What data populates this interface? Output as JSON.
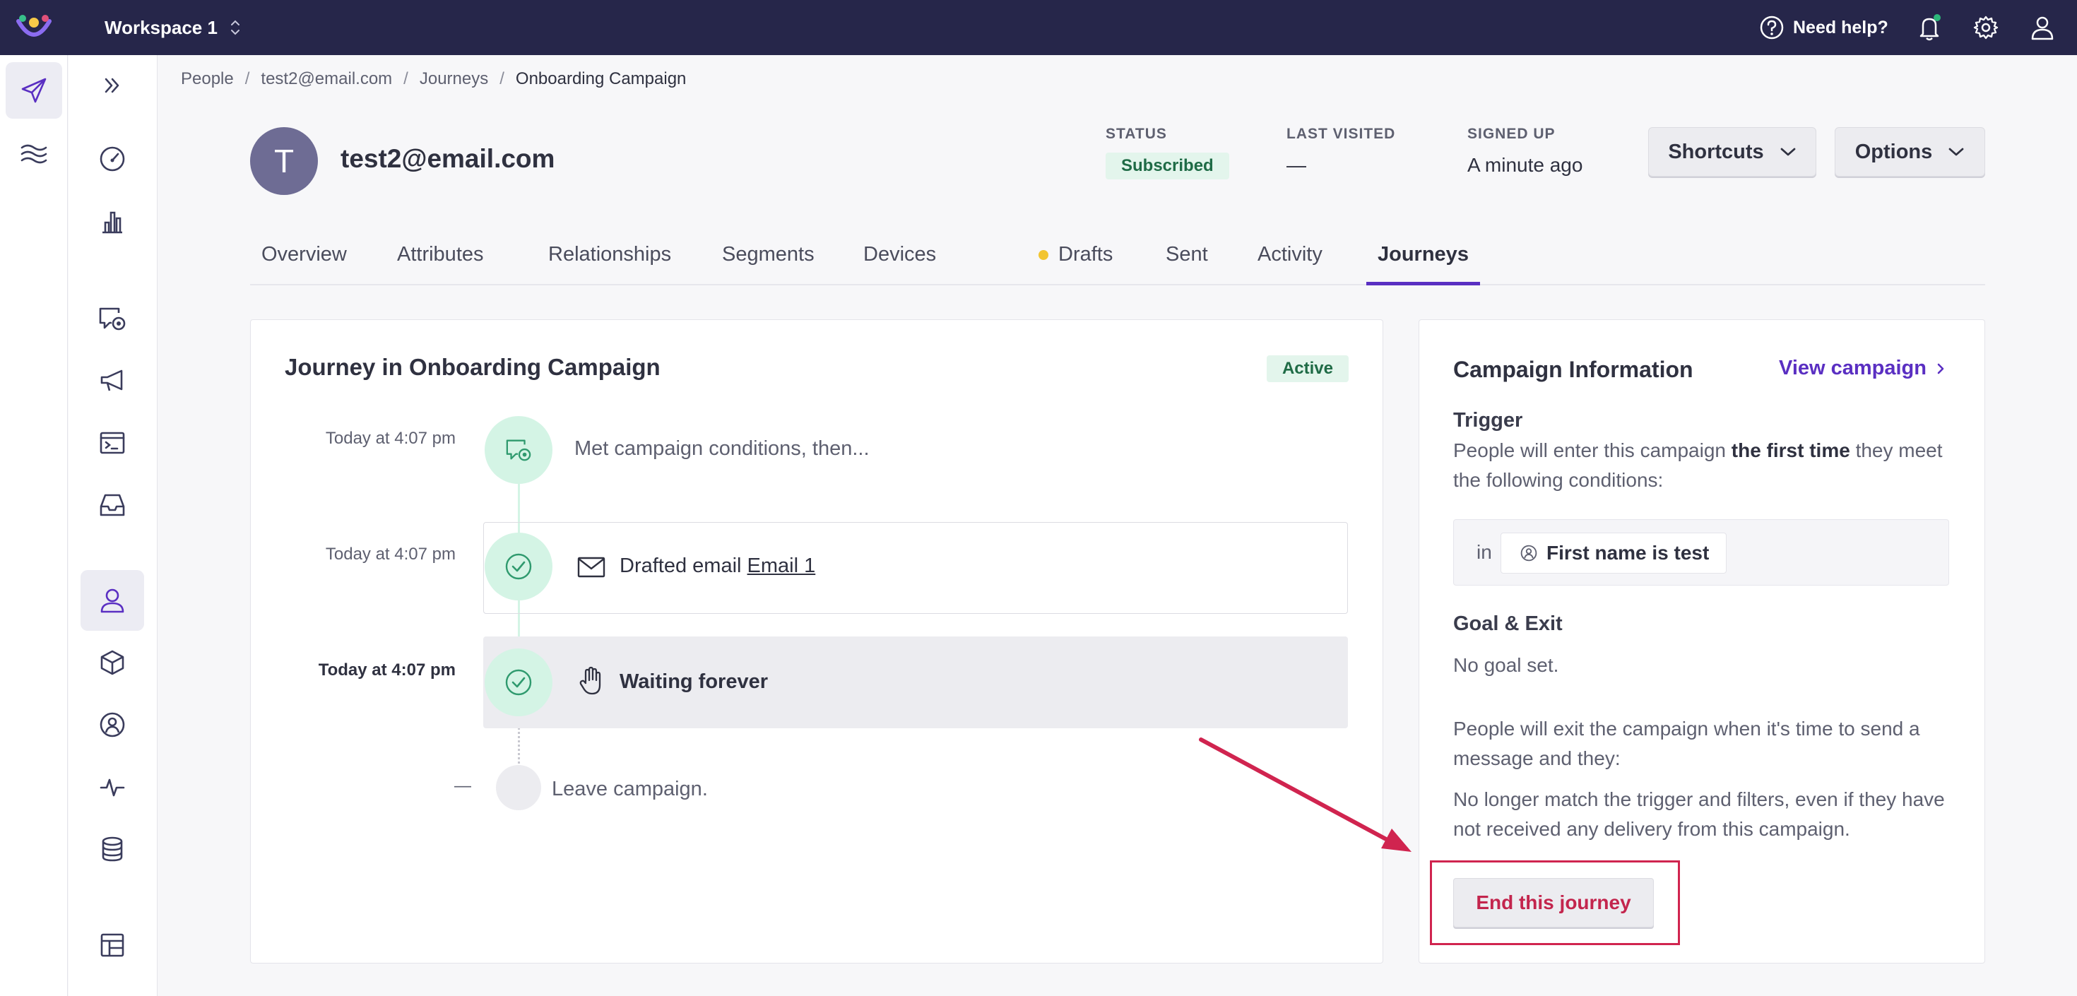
{
  "topbar": {
    "workspace": "Workspace 1",
    "help_label": "Need help?",
    "colors": {
      "background": "#26264a",
      "notification_dot": "#2db87a"
    }
  },
  "breadcrumb": [
    "People",
    "test2@email.com",
    "Journeys",
    "Onboarding Campaign"
  ],
  "profile": {
    "initial": "T",
    "email": "test2@email.com",
    "status_label": "STATUS",
    "status_value": "Subscribed",
    "last_visited_label": "LAST VISITED",
    "last_visited_value": "—",
    "signed_up_label": "SIGNED UP",
    "signed_up_value": "A minute ago",
    "shortcuts_label": "Shortcuts",
    "options_label": "Options"
  },
  "tabs": [
    "Overview",
    "Attributes",
    "Relationships",
    "Segments",
    "Devices",
    "Drafts",
    "Sent",
    "Activity",
    "Journeys"
  ],
  "active_tab": "Journeys",
  "journey": {
    "title": "Journey in Onboarding Campaign",
    "badge": "Active",
    "steps": [
      {
        "time": "Today at 4:07 pm",
        "text": "Met campaign conditions, then..."
      },
      {
        "time": "Today at 4:07 pm",
        "text_prefix": "Drafted email",
        "link": "Email 1"
      },
      {
        "time": "Today at 4:07 pm",
        "text": "Waiting forever"
      },
      {
        "time": "—",
        "text": "Leave campaign."
      }
    ]
  },
  "campaign_info": {
    "title": "Campaign Information",
    "view_link": "View campaign",
    "trigger_heading": "Trigger",
    "trigger_text_pre": "People will enter this campaign",
    "trigger_text_bold": "the first time",
    "trigger_text_post": "they meet the following conditions:",
    "condition_in": "in",
    "condition": "First name is test",
    "goal_heading": "Goal & Exit",
    "goal_text": "No goal set.",
    "exit_text": "People will exit the campaign when it's time to send a message and they:",
    "exit_condition": "No longer match the trigger and filters, even if they have not received any delivery from this campaign.",
    "end_button": "End this journey"
  },
  "annotation_color": "#d0244f",
  "accent_color": "#5a2fc2"
}
